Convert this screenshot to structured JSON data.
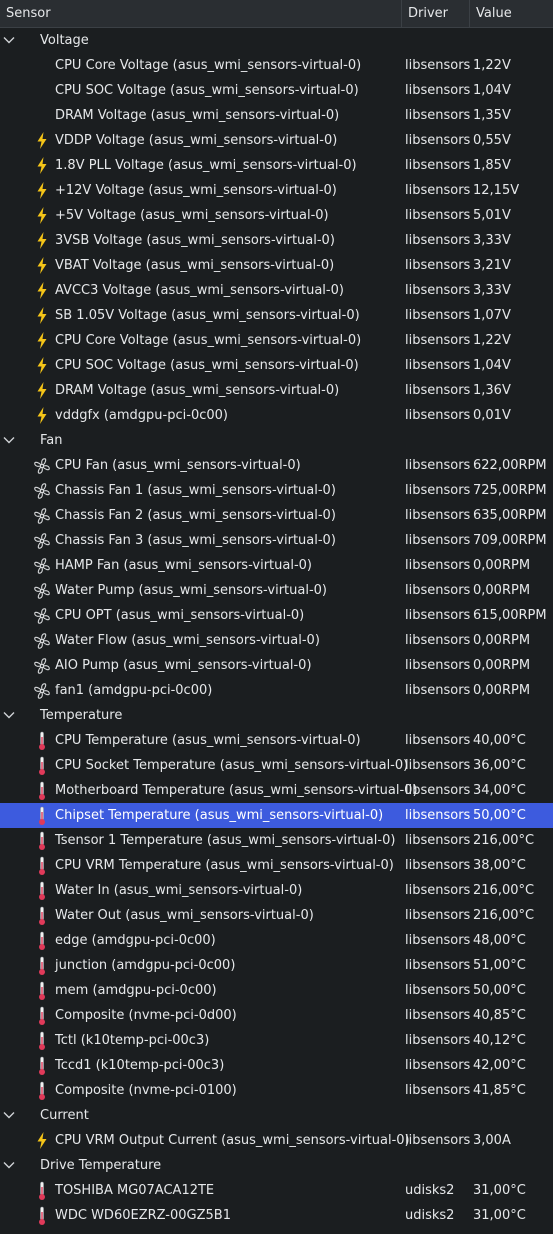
{
  "columns": {
    "sensor": "Sensor",
    "driver": "Driver",
    "value": "Value"
  },
  "colors": {
    "bolt": "#f5c518",
    "fan": "#d8dadc",
    "thermo": "#e03a5a",
    "selected": "#3d5bde"
  },
  "groups": [
    {
      "name": "Voltage",
      "items": [
        {
          "icon": "none",
          "name": "CPU Core Voltage (asus_wmi_sensors-virtual-0)",
          "driver": "libsensors",
          "value": "1,22V"
        },
        {
          "icon": "none",
          "name": "CPU SOC Voltage (asus_wmi_sensors-virtual-0)",
          "driver": "libsensors",
          "value": "1,04V"
        },
        {
          "icon": "none",
          "name": "DRAM Voltage (asus_wmi_sensors-virtual-0)",
          "driver": "libsensors",
          "value": "1,35V"
        },
        {
          "icon": "bolt",
          "name": "VDDP Voltage (asus_wmi_sensors-virtual-0)",
          "driver": "libsensors",
          "value": "0,55V"
        },
        {
          "icon": "bolt",
          "name": "1.8V PLL Voltage (asus_wmi_sensors-virtual-0)",
          "driver": "libsensors",
          "value": "1,85V"
        },
        {
          "icon": "bolt",
          "name": "+12V Voltage (asus_wmi_sensors-virtual-0)",
          "driver": "libsensors",
          "value": "12,15V"
        },
        {
          "icon": "bolt",
          "name": "+5V Voltage (asus_wmi_sensors-virtual-0)",
          "driver": "libsensors",
          "value": "5,01V"
        },
        {
          "icon": "bolt",
          "name": "3VSB Voltage (asus_wmi_sensors-virtual-0)",
          "driver": "libsensors",
          "value": "3,33V"
        },
        {
          "icon": "bolt",
          "name": "VBAT Voltage (asus_wmi_sensors-virtual-0)",
          "driver": "libsensors",
          "value": "3,21V"
        },
        {
          "icon": "bolt",
          "name": "AVCC3 Voltage (asus_wmi_sensors-virtual-0)",
          "driver": "libsensors",
          "value": "3,33V"
        },
        {
          "icon": "bolt",
          "name": "SB 1.05V Voltage (asus_wmi_sensors-virtual-0)",
          "driver": "libsensors",
          "value": "1,07V"
        },
        {
          "icon": "bolt",
          "name": "CPU Core Voltage (asus_wmi_sensors-virtual-0)",
          "driver": "libsensors",
          "value": "1,22V"
        },
        {
          "icon": "bolt",
          "name": "CPU SOC Voltage (asus_wmi_sensors-virtual-0)",
          "driver": "libsensors",
          "value": "1,04V"
        },
        {
          "icon": "bolt",
          "name": "DRAM Voltage (asus_wmi_sensors-virtual-0)",
          "driver": "libsensors",
          "value": "1,36V"
        },
        {
          "icon": "bolt",
          "name": "vddgfx (amdgpu-pci-0c00)",
          "driver": "libsensors",
          "value": "0,01V"
        }
      ]
    },
    {
      "name": "Fan",
      "items": [
        {
          "icon": "fan",
          "name": "CPU Fan (asus_wmi_sensors-virtual-0)",
          "driver": "libsensors",
          "value": "622,00RPM"
        },
        {
          "icon": "fan",
          "name": "Chassis Fan 1 (asus_wmi_sensors-virtual-0)",
          "driver": "libsensors",
          "value": "725,00RPM"
        },
        {
          "icon": "fan",
          "name": "Chassis Fan 2 (asus_wmi_sensors-virtual-0)",
          "driver": "libsensors",
          "value": "635,00RPM"
        },
        {
          "icon": "fan",
          "name": "Chassis Fan 3 (asus_wmi_sensors-virtual-0)",
          "driver": "libsensors",
          "value": "709,00RPM"
        },
        {
          "icon": "fan",
          "name": "HAMP Fan (asus_wmi_sensors-virtual-0)",
          "driver": "libsensors",
          "value": "0,00RPM"
        },
        {
          "icon": "fan",
          "name": "Water Pump (asus_wmi_sensors-virtual-0)",
          "driver": "libsensors",
          "value": "0,00RPM"
        },
        {
          "icon": "fan",
          "name": "CPU OPT (asus_wmi_sensors-virtual-0)",
          "driver": "libsensors",
          "value": "615,00RPM"
        },
        {
          "icon": "fan",
          "name": "Water Flow (asus_wmi_sensors-virtual-0)",
          "driver": "libsensors",
          "value": "0,00RPM"
        },
        {
          "icon": "fan",
          "name": "AIO Pump (asus_wmi_sensors-virtual-0)",
          "driver": "libsensors",
          "value": "0,00RPM"
        },
        {
          "icon": "fan",
          "name": "fan1 (amdgpu-pci-0c00)",
          "driver": "libsensors",
          "value": "0,00RPM"
        }
      ]
    },
    {
      "name": "Temperature",
      "items": [
        {
          "icon": "thermo",
          "name": "CPU Temperature (asus_wmi_sensors-virtual-0)",
          "driver": "libsensors",
          "value": "40,00°C"
        },
        {
          "icon": "thermo",
          "name": "CPU Socket Temperature (asus_wmi_sensors-virtual-0)",
          "driver": "libsensors",
          "value": "36,00°C"
        },
        {
          "icon": "thermo",
          "name": "Motherboard Temperature (asus_wmi_sensors-virtual-0)",
          "driver": "libsensors",
          "value": "34,00°C"
        },
        {
          "icon": "thermo",
          "name": "Chipset Temperature (asus_wmi_sensors-virtual-0)",
          "driver": "libsensors",
          "value": "50,00°C",
          "selected": true
        },
        {
          "icon": "thermo",
          "name": "Tsensor 1 Temperature (asus_wmi_sensors-virtual-0)",
          "driver": "libsensors",
          "value": "216,00°C"
        },
        {
          "icon": "thermo",
          "name": "CPU VRM Temperature (asus_wmi_sensors-virtual-0)",
          "driver": "libsensors",
          "value": "38,00°C"
        },
        {
          "icon": "thermo",
          "name": "Water In (asus_wmi_sensors-virtual-0)",
          "driver": "libsensors",
          "value": "216,00°C"
        },
        {
          "icon": "thermo",
          "name": "Water Out (asus_wmi_sensors-virtual-0)",
          "driver": "libsensors",
          "value": "216,00°C"
        },
        {
          "icon": "thermo",
          "name": "edge (amdgpu-pci-0c00)",
          "driver": "libsensors",
          "value": "48,00°C"
        },
        {
          "icon": "thermo",
          "name": "junction (amdgpu-pci-0c00)",
          "driver": "libsensors",
          "value": "51,00°C"
        },
        {
          "icon": "thermo",
          "name": "mem (amdgpu-pci-0c00)",
          "driver": "libsensors",
          "value": "50,00°C"
        },
        {
          "icon": "thermo",
          "name": "Composite (nvme-pci-0d00)",
          "driver": "libsensors",
          "value": "40,85°C"
        },
        {
          "icon": "thermo",
          "name": "Tctl (k10temp-pci-00c3)",
          "driver": "libsensors",
          "value": "40,12°C"
        },
        {
          "icon": "thermo",
          "name": "Tccd1 (k10temp-pci-00c3)",
          "driver": "libsensors",
          "value": "42,00°C"
        },
        {
          "icon": "thermo",
          "name": "Composite (nvme-pci-0100)",
          "driver": "libsensors",
          "value": "41,85°C"
        }
      ]
    },
    {
      "name": "Current",
      "items": [
        {
          "icon": "bolt",
          "name": "CPU VRM Output Current (asus_wmi_sensors-virtual-0)",
          "driver": "libsensors",
          "value": "3,00A"
        }
      ]
    },
    {
      "name": "Drive Temperature",
      "items": [
        {
          "icon": "thermo",
          "name": "TOSHIBA MG07ACA12TE",
          "driver": "udisks2",
          "value": "31,00°C"
        },
        {
          "icon": "thermo",
          "name": "WDC WD60EZRZ-00GZ5B1",
          "driver": "udisks2",
          "value": "31,00°C"
        }
      ]
    }
  ]
}
